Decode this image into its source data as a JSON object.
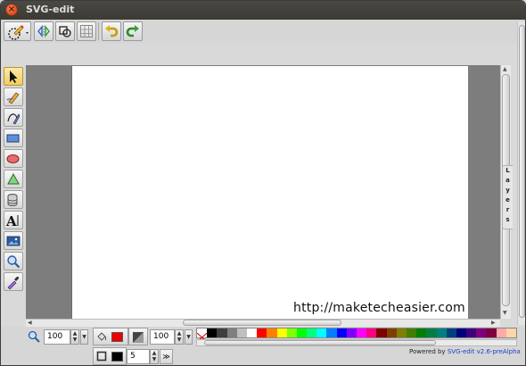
{
  "window": {
    "title": "SVG-edit"
  },
  "toolbar": {
    "logo_icon": "svg-edit-logo-icon",
    "buttons": [
      "wireframe-icon",
      "source-icon",
      "grid-icon",
      "undo-icon",
      "redo-icon"
    ]
  },
  "left_tools": [
    "select-icon",
    "pencil-icon",
    "path-icon",
    "rect-icon",
    "ellipse-icon",
    "polygon-icon",
    "library-icon",
    "text-icon",
    "image-icon",
    "zoom-icon",
    "eyedropper-icon"
  ],
  "layers_panel": {
    "label": "Layers"
  },
  "bottom": {
    "zoom_value": "100",
    "fill_opacity": "100",
    "stroke_width": "5",
    "fill_color": "#ee0000",
    "stroke_color": "#000000",
    "more_label": "≫"
  },
  "palette": [
    "#000000",
    "#3f3f3f",
    "#7f7f7f",
    "#bfbfbf",
    "#ffffff",
    "#ff0000",
    "#ff7f00",
    "#ffff00",
    "#7fff00",
    "#00ff00",
    "#00ff7f",
    "#00ffff",
    "#007fff",
    "#0000ff",
    "#7f00ff",
    "#ff00ff",
    "#ff007f",
    "#7f0000",
    "#7f3f00",
    "#7f7f00",
    "#3f7f00",
    "#007f00",
    "#007f3f",
    "#007f7f",
    "#003f7f",
    "#00007f",
    "#3f007f",
    "#7f007f",
    "#7f003f",
    "#ffaaaa",
    "#ffd4aa"
  ],
  "footer": {
    "powered_prefix": "Powered by",
    "powered_link": "SVG-edit v2.6-preAlpha"
  },
  "watermark": "http://maketecheasier.com"
}
